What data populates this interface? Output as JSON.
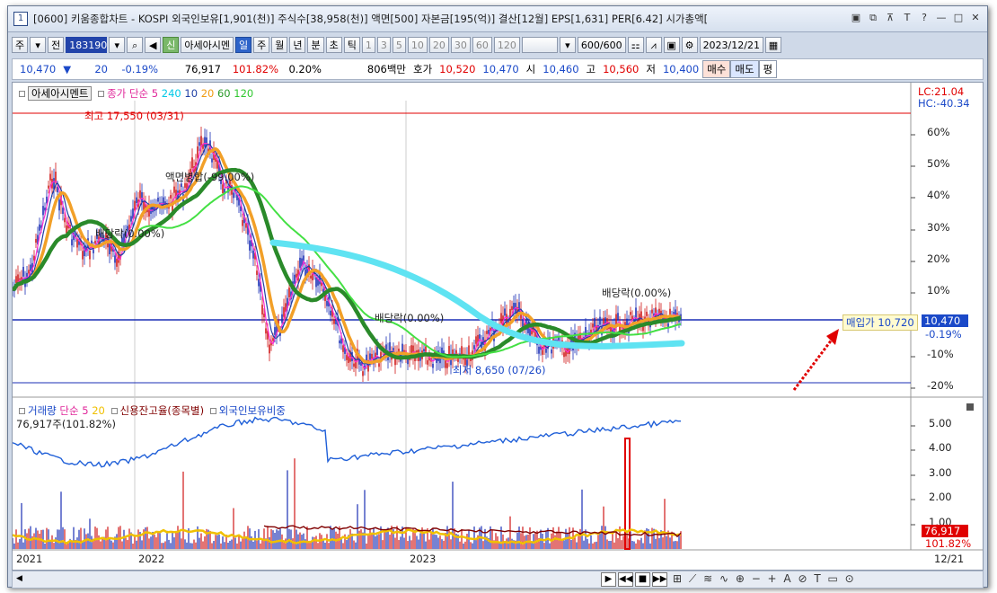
{
  "window": {
    "number": "1",
    "title": "[0600] 키움종합차트 - KOSPI 외국인보유[1,901(천)] 주식수[38,958(천)] 액면[500] 자본금[195(억)] 결산[12월] EPS[1,631] PER[6.42] 시가총액[",
    "controls": [
      "▣",
      "⧉",
      "⊼",
      "T",
      "?",
      "—",
      "□",
      "✕"
    ]
  },
  "toolbar": {
    "type_select": "주",
    "period_select": "전",
    "code": "183190",
    "stock_name": "아세아시멘",
    "new_label": "신",
    "tabs": [
      "일",
      "주",
      "월",
      "년",
      "분",
      "초",
      "틱"
    ],
    "active_tab": "일",
    "intervals": [
      "1",
      "3",
      "5",
      "10",
      "20",
      "30",
      "60",
      "120"
    ],
    "count": "600",
    "total": "/600",
    "date": "2023/12/21"
  },
  "quote": {
    "price": "10,470",
    "arrow": "▼",
    "change": "20",
    "change_pct": "-0.19%",
    "volume": "76,917",
    "volume_ratio": "101.82%",
    "turnover_pct": "0.20%",
    "amount": "806백만",
    "hoga_label": "호가",
    "ask": "10,520",
    "bid": "10,470",
    "open_label": "시",
    "open": "10,460",
    "high_label": "고",
    "high": "10,560",
    "low_label": "저",
    "low": "10,400",
    "buy_btn": "매수",
    "sell_btn": "매도",
    "eval_btn": "평"
  },
  "price_panel": {
    "stock_tab": "아세아시멘트",
    "legend_close": "종가",
    "legend_ma": "단순",
    "ma_periods": [
      "5",
      "240",
      "10",
      "20",
      "60",
      "120"
    ],
    "ma_colors": [
      "#ff00ff",
      "#00e5ff",
      "#1f3fa5",
      "#ff9f1a",
      "#2a9a2a",
      "#44e044"
    ],
    "lc": "LC:21.04",
    "hc": "HC:-40.34",
    "high_note": "최고 17,550 (03/31)",
    "low_note": "최저 8,650 (07/26)",
    "events": [
      "액면병합(-99.00%)",
      "배당락(0.00%)",
      "배당락(0.00%)",
      "배당락(0.00%)"
    ],
    "buy_price_label": "매입가 10,720",
    "last_price": "10,470",
    "last_pct": "-0.19%",
    "y_ticks": [
      "60%",
      "50%",
      "40%",
      "30%",
      "20%",
      "10%",
      "0%",
      "-10%",
      "-20%"
    ]
  },
  "volume_panel": {
    "legend_vol": "거래량",
    "legend_ma": "단순",
    "ma_periods": [
      "5",
      "20"
    ],
    "legend_credit": "신용잔고율(종목별)",
    "legend_foreign": "외국인보유비중",
    "current": "76,917주(101.82%)",
    "y_ticks": [
      "5.00",
      "4.00",
      "3.00",
      "2.00",
      "1.00"
    ],
    "last_vol": "76,917",
    "last_ratio": "101.82%"
  },
  "x_axis": {
    "labels": [
      "2021",
      "2022",
      "2023"
    ],
    "last": "12/21"
  },
  "scrollbar": {
    "left_arrow": "◀",
    "controls": [
      "▶",
      "◀◀",
      "■",
      "▶▶"
    ],
    "tools": "⊞ ⟋ ≋ ∿ ⊕ − + A ⊘ T ▭ ⊙"
  }
}
